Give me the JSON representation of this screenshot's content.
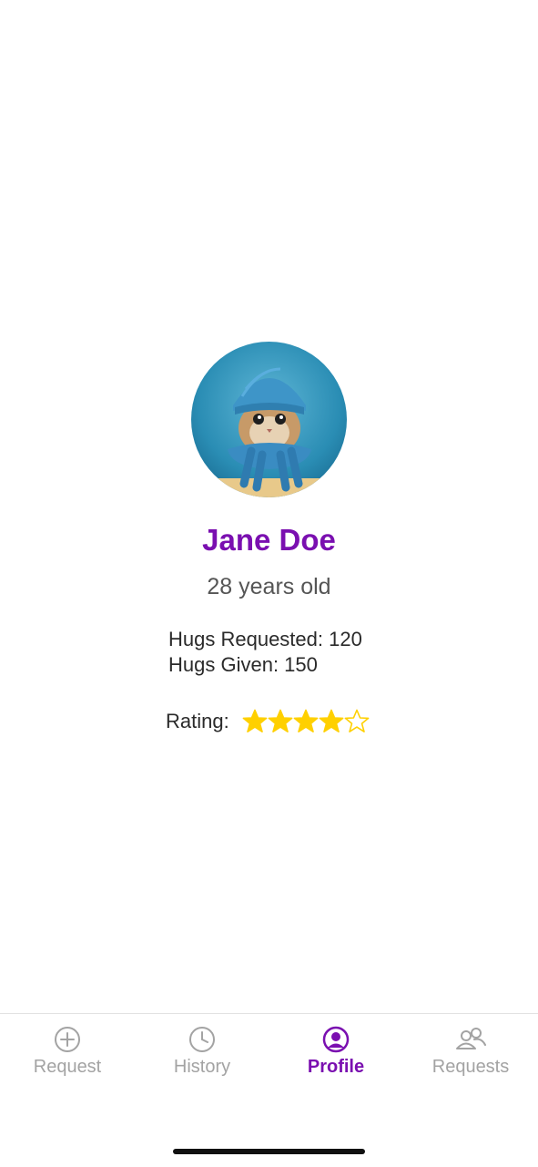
{
  "profile": {
    "name": "Jane Doe",
    "age_text": "28 years old",
    "hugs_requested": "Hugs Requested: 120",
    "hugs_given": "Hugs Given: 150",
    "rating_label": "Rating:",
    "rating_value": 4,
    "rating_max": 5,
    "avatar_description": "kitten-in-blue-knit-hat-and-scarf"
  },
  "tabbar": {
    "tabs": [
      {
        "label": "Request",
        "icon": "plus-circle-icon",
        "active": false
      },
      {
        "label": "History",
        "icon": "clock-icon",
        "active": false
      },
      {
        "label": "Profile",
        "icon": "user-circle-icon",
        "active": true
      },
      {
        "label": "Requests",
        "icon": "users-icon",
        "active": false
      }
    ]
  },
  "colors": {
    "accent": "#7a0fb0",
    "inactive": "#a3a3a3",
    "star": "#ffd000"
  }
}
